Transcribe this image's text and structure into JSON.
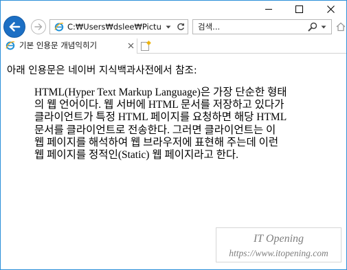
{
  "browser": {
    "address": "C:₩Users₩dslee₩Pictures₩",
    "search_placeholder": "검색...",
    "tab_title": "기본 인용문 개념익히기"
  },
  "page": {
    "intro": "아래 인용문은 네이버 지식백과사전에서 참조:",
    "quote_lines": [
      "HTML(Hyper Text Markup Language)은 가장 단순한 형태",
      "의 웹 언어이다. 웹 서버에 HTML 문서를 저장하고 있다가",
      "클라이언트가 특정 HTML 페이지를 요청하면 해당 HTML",
      "문서를 클라이언트로 전송한다. 그러면 클라이언트는 이",
      "웹 페이지를 해석하여 웹 브라우저에 표현해 주는데 이런",
      "웹 페이지를 정적인(Static) 웹 페이지라고 한다."
    ]
  },
  "watermark": {
    "title": "IT Opening",
    "url": "https://www.itopening.com"
  },
  "icons": {
    "back": "back-arrow-icon",
    "forward": "forward-arrow-icon",
    "browser": "ie-logo-icon",
    "refresh": "refresh-icon",
    "search": "magnifier-icon",
    "home": "home-icon",
    "new_tab": "new-tab-icon",
    "close": "close-icon"
  },
  "colors": {
    "accent": "#1c6fc4",
    "window_border": "#2b8fd9",
    "watermark_text": "#7e7e7e"
  }
}
